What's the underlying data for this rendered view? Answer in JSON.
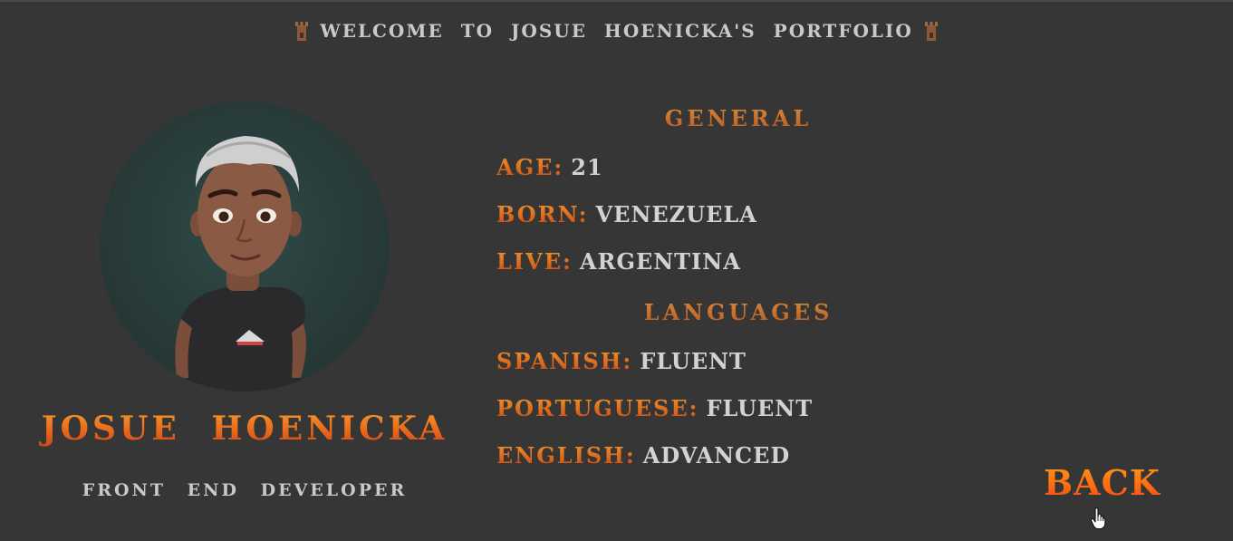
{
  "header": {
    "welcome_text": "WELCOME TO JOSUE HOENICKA'S PORTFOLIO",
    "left_icon": "tower-icon",
    "right_icon": "tower-icon"
  },
  "profile": {
    "name": "JOSUE HOENICKA",
    "role": "FRONT END DEVELOPER",
    "avatar_icon": "avatar-illustration"
  },
  "general": {
    "title": "GENERAL",
    "items": [
      {
        "label": "AGE:",
        "value": "21"
      },
      {
        "label": "BORN:",
        "value": "VENEZUELA"
      },
      {
        "label": "LIVE:",
        "value": "ARGENTINA"
      }
    ]
  },
  "languages": {
    "title": "LANGUAGES",
    "items": [
      {
        "label": "SPANISH:",
        "value": "FLUENT"
      },
      {
        "label": "PORTUGUESE:",
        "value": "FLUENT"
      },
      {
        "label": "ENGLISH:",
        "value": "ADVANCED"
      }
    ]
  },
  "nav": {
    "back_label": "BACK",
    "cursor_icon": "hand-pointer-icon"
  },
  "colors": {
    "background": "#363636",
    "accent_orange": "#f07a1a",
    "text_light": "#cfcfcf",
    "avatar_bg": "#273a38"
  }
}
